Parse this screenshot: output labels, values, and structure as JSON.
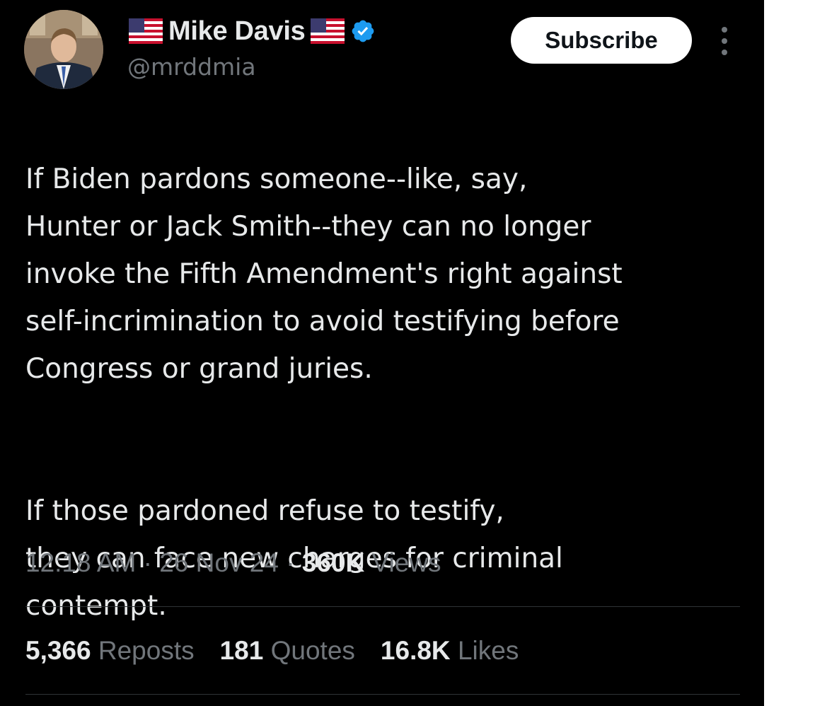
{
  "author": {
    "display_name": "Mike Davis",
    "handle": "@mrddmia",
    "avatar_icon": "profile-photo",
    "flag_icon": "us-flag-emoji",
    "verified_icon": "verified-badge-icon",
    "verified_color": "#1d9bf0"
  },
  "actions": {
    "subscribe_label": "Subscribe",
    "more_icon": "more-options-icon"
  },
  "tweet": {
    "paragraphs": [
      "If Biden pardons someone--like, say,\nHunter or Jack Smith--they can no longer\ninvoke the Fifth Amendment's right against\nself-incrimination to avoid testifying before\nCongress or grand juries.",
      "If those pardoned refuse to testify,\nthey can face new charges for criminal\ncontempt."
    ]
  },
  "meta": {
    "time": "12:18 AM",
    "separator": "·",
    "date": "26 Nov 24",
    "views_count": "360K",
    "views_label": "Views"
  },
  "stats": {
    "reposts_count": "5,366",
    "reposts_label": "Reposts",
    "quotes_count": "181",
    "quotes_label": "Quotes",
    "likes_count": "16.8K",
    "likes_label": "Likes"
  },
  "colors": {
    "background": "#000000",
    "primary_text": "#e7e9ea",
    "secondary_text": "#71767b",
    "divider": "#2f3336"
  }
}
